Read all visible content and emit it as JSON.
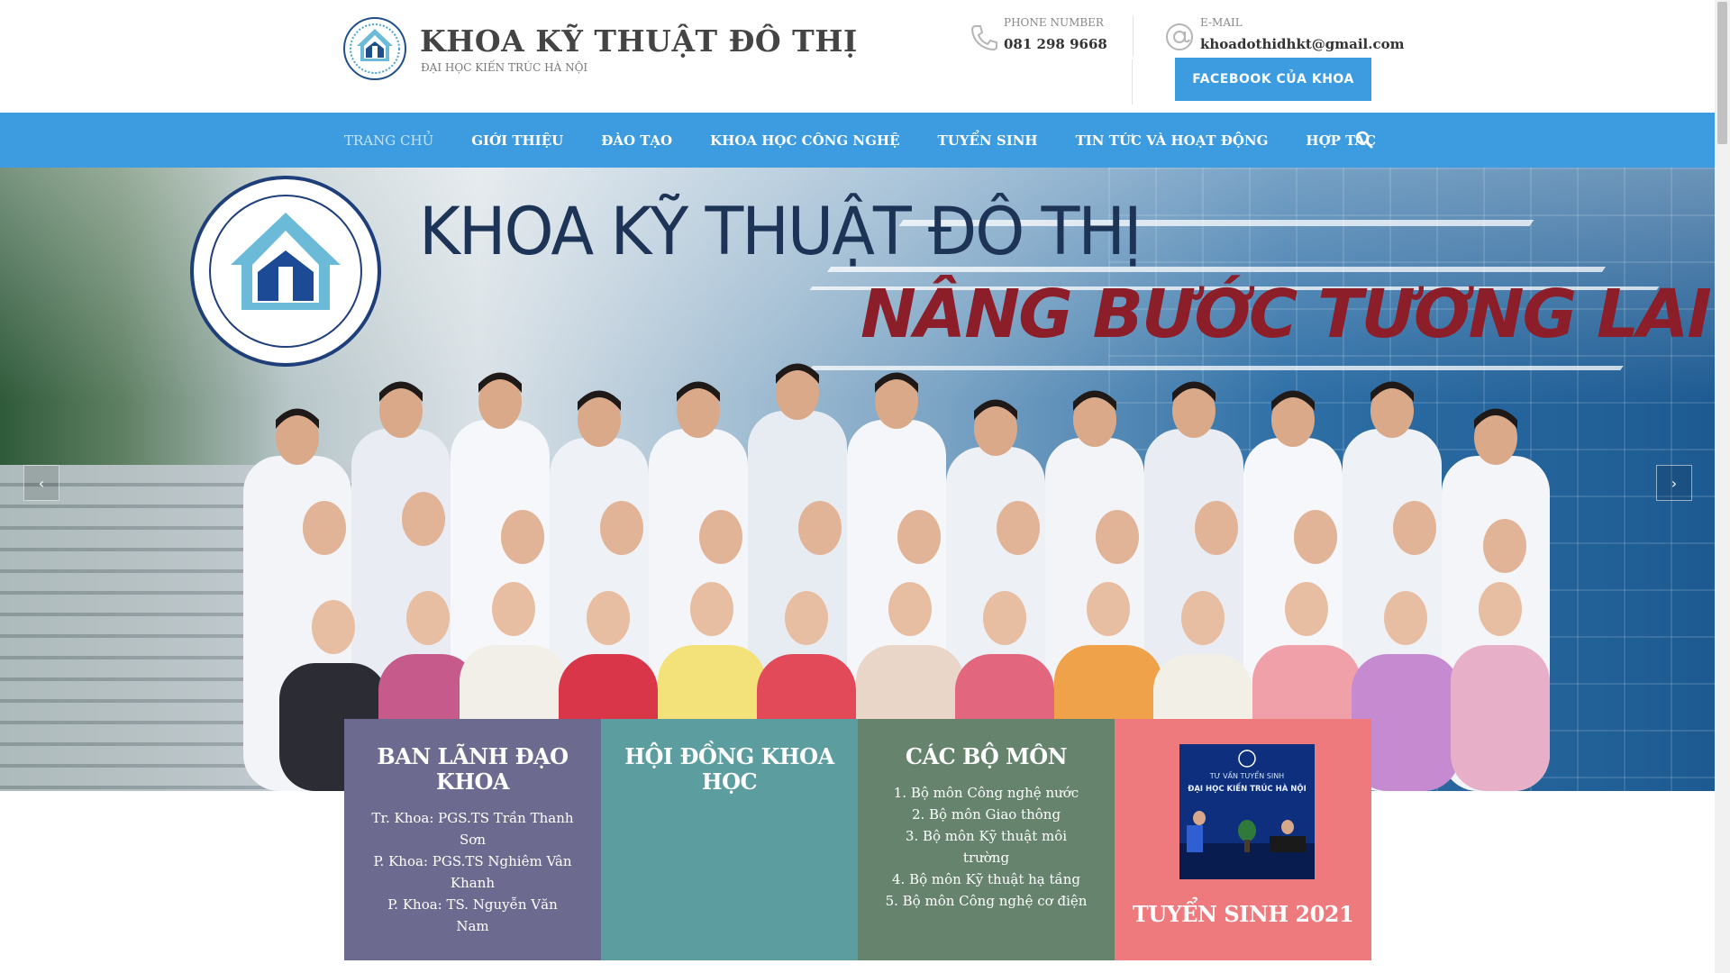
{
  "header": {
    "site_title": "KHOA KỸ THUẬT ĐÔ THỊ",
    "site_subtitle": "ĐẠI HỌC KIẾN TRÚC HÀ NỘI",
    "phone_label": "PHONE NUMBER",
    "phone_value": "081 298 9668",
    "email_label": "E-MAIL",
    "email_value": "khoadothidhkt@gmail.com",
    "facebook_button": "FACEBOOK CỦA KHOA"
  },
  "nav": {
    "items": [
      {
        "label": "TRANG CHỦ",
        "active": true
      },
      {
        "label": "GIỚI THIỆU"
      },
      {
        "label": "ĐÀO TẠO"
      },
      {
        "label": "KHOA HỌC CÔNG NGHỆ"
      },
      {
        "label": "TUYỂN SINH"
      },
      {
        "label": "TIN TỨC VÀ HOẠT ĐỘNG"
      },
      {
        "label": "HỢP TÁC"
      }
    ],
    "search_icon": "search-icon"
  },
  "hero": {
    "title": "KHOA KỸ THUẬT ĐÔ THỊ",
    "slogan": "NÂNG BƯỚC TƯƠNG LAI",
    "prev": "‹",
    "next": "›"
  },
  "boxes": {
    "leadership": {
      "title": "BAN LÃNH ĐẠO KHOA",
      "lines": [
        "Tr. Khoa: PGS.TS Trần Thanh Sơn",
        "P. Khoa: PGS.TS Nghiêm Vân Khanh",
        "P. Khoa: TS. Nguyễn Văn Nam"
      ]
    },
    "council": {
      "title": "HỘI ĐỒNG KHOA HỌC"
    },
    "departments": {
      "title": "CÁC BỘ MÔN",
      "lines": [
        "1. Bộ môn Công nghệ nước",
        "2. Bộ môn Giao thông",
        "3. Bộ môn Kỹ thuật môi trường",
        "4. Bộ môn Kỹ thuật hạ tầng",
        "5. Bộ môn Công nghệ cơ điện"
      ]
    },
    "admission": {
      "thumb_line1": "TƯ VẤN TUYỂN SINH",
      "thumb_line2": "ĐẠI HỌC KIẾN TRÚC HÀ NỘI",
      "title": "TUYỂN SINH 2021"
    }
  },
  "colors": {
    "nav": "#3d9be0",
    "leadership": "#6c6a8e",
    "council": "#5c9ea0",
    "departments": "#65836d",
    "admission": "#ee7a7d"
  }
}
